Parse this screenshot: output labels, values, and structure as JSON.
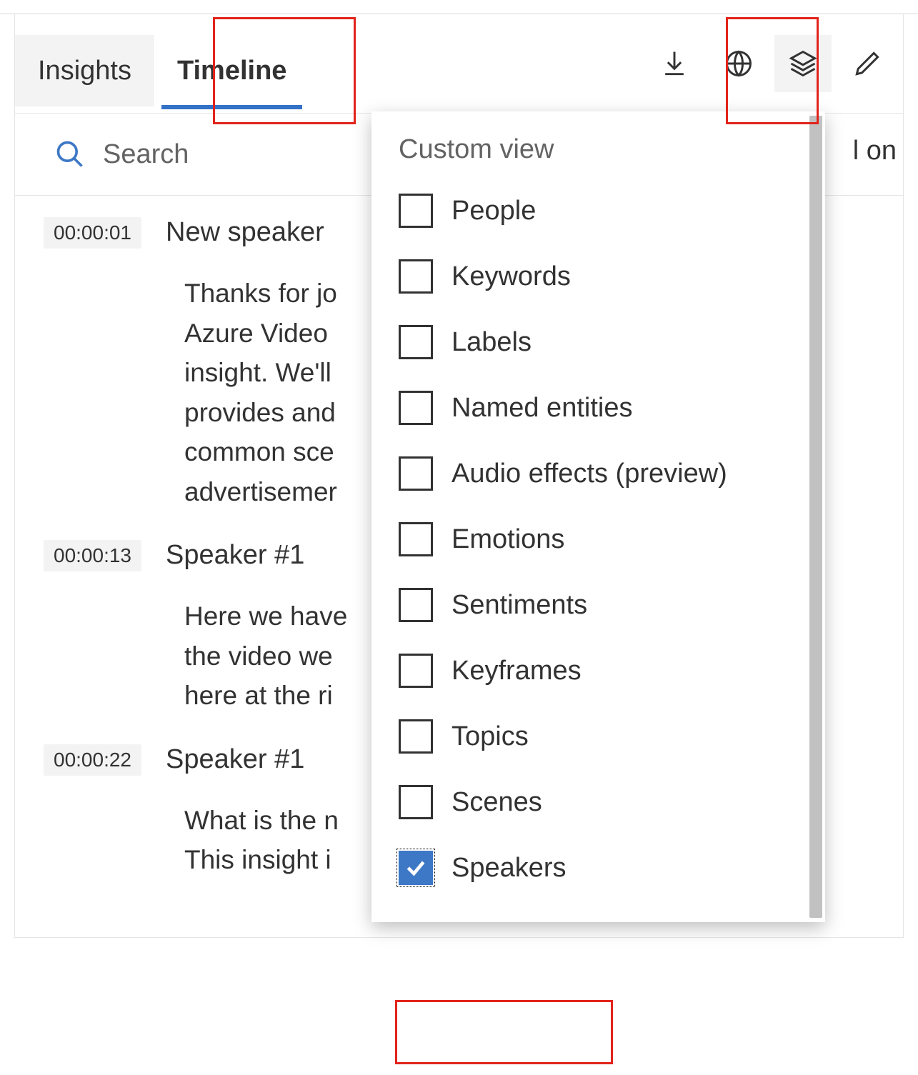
{
  "tabs": {
    "insights": "Insights",
    "timeline": "Timeline"
  },
  "search": {
    "placeholder": "Search"
  },
  "hidden_trail": "l on",
  "transcript": [
    {
      "ts": "00:00:01",
      "speaker": "New speaker",
      "body": "Thanks for jo\nAzure Video \ninsight. We'll\nprovides and\ncommon sce\nadvertisemer"
    },
    {
      "ts": "00:00:13",
      "speaker": "Speaker #1",
      "body": "Here we have\nthe video we\nhere at the ri"
    },
    {
      "ts": "00:00:22",
      "speaker": "Speaker #1",
      "body": "What is the n\nThis insight i"
    }
  ],
  "dropdown": {
    "title": "Custom view",
    "items": [
      {
        "label": "People",
        "checked": false
      },
      {
        "label": "Keywords",
        "checked": false
      },
      {
        "label": "Labels",
        "checked": false
      },
      {
        "label": "Named entities",
        "checked": false
      },
      {
        "label": "Audio effects (preview)",
        "checked": false
      },
      {
        "label": "Emotions",
        "checked": false
      },
      {
        "label": "Sentiments",
        "checked": false
      },
      {
        "label": "Keyframes",
        "checked": false
      },
      {
        "label": "Topics",
        "checked": false
      },
      {
        "label": "Scenes",
        "checked": false
      },
      {
        "label": "Speakers",
        "checked": true
      }
    ]
  }
}
